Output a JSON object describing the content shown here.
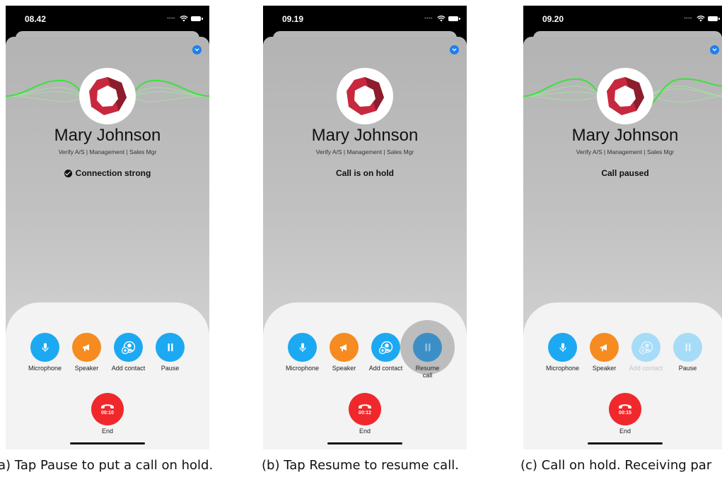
{
  "screens": [
    {
      "clock": "08.42",
      "contact": {
        "name": "Mary Johnson",
        "role": "Verify A/S | Management | Sales Mgr"
      },
      "status_text": "Connection strong",
      "controls": {
        "microphone": "Microphone",
        "speaker": "Speaker",
        "add_contact": "Add contact",
        "pause": "Pause"
      },
      "timer": "00:10",
      "end_label": "End",
      "caption": "(a) Tap Pause to put a call on hold."
    },
    {
      "clock": "09.19",
      "contact": {
        "name": "Mary Johnson",
        "role": "Verify A/S | Management | Sales Mgr"
      },
      "status_text": "Call is on hold",
      "controls": {
        "microphone": "Microphone",
        "speaker": "Speaker",
        "add_contact": "Add contact",
        "resume": "Resume call"
      },
      "timer": "00:12",
      "end_label": "End",
      "caption": "(b) Tap Resume to resume call."
    },
    {
      "clock": "09.20",
      "contact": {
        "name": "Mary Johnson",
        "role": "Verify A/S | Management | Sales Mgr"
      },
      "status_text": "Call paused",
      "controls": {
        "microphone": "Microphone",
        "speaker": "Speaker",
        "add_contact": "Add contact",
        "pause": "Pause"
      },
      "timer": "00:15",
      "end_label": "End",
      "caption": "(c) Call on hold. Receiving par"
    }
  ],
  "colors": {
    "accent_blue": "#1ca9f2",
    "speaker_orange": "#f68b1f",
    "end_red": "#f0282b",
    "wave_green": "#3ae23a",
    "logo_red": "#c8283e"
  },
  "icons": [
    "microphone-icon",
    "megaphone-icon",
    "add-contact-icon",
    "pause-icon",
    "hang-up-icon",
    "chevron-down-icon",
    "wifi-icon",
    "battery-icon",
    "checkmark-icon"
  ]
}
